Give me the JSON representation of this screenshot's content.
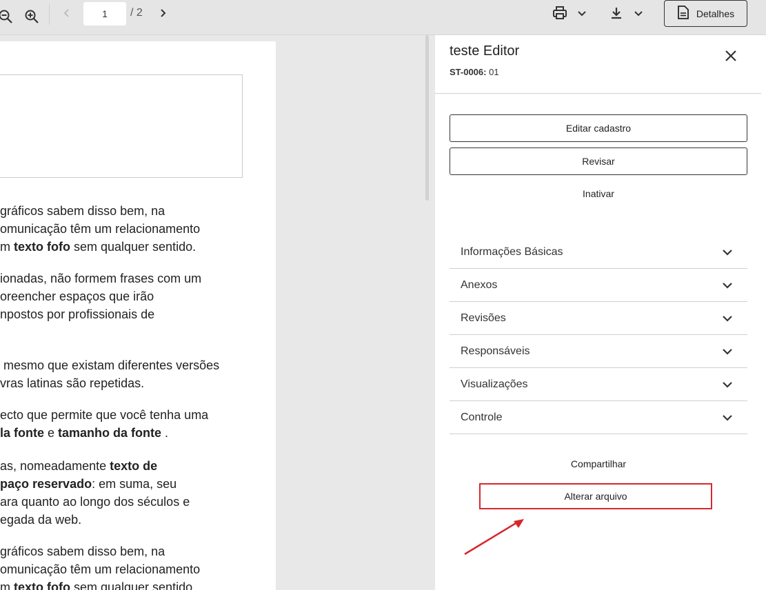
{
  "toolbar": {
    "page_current": "1",
    "page_total": "/ 2",
    "details_label": "Detalhes"
  },
  "document": {
    "lines": [
      {
        "parts": [
          {
            "t": "gráficos sabem disso bem, na"
          }
        ]
      },
      {
        "parts": [
          {
            "t": "omunicação têm um relacionamento"
          }
        ]
      },
      {
        "parts": [
          {
            "t": "m "
          },
          {
            "t": "texto fofo",
            "b": true
          },
          {
            "t": " sem qualquer sentido."
          }
        ]
      },
      {
        "parts": [
          {
            "t": "ionadas, não formem frases com um"
          }
        ]
      },
      {
        "parts": [
          {
            "t": "oreencher espaços que irão"
          }
        ]
      },
      {
        "parts": [
          {
            "t": "npostos por profissionais de"
          }
        ]
      },
      {
        "parts": [
          {
            "t": " mesmo que existam diferentes versões"
          }
        ]
      },
      {
        "parts": [
          {
            "t": "vras latinas são repetidas."
          }
        ]
      },
      {
        "parts": [
          {
            "t": "ecto que permite que você tenha uma"
          }
        ]
      },
      {
        "parts": [
          {
            "t": "la fonte",
            "b": true
          },
          {
            "t": " e "
          },
          {
            "t": "tamanho da fonte",
            "b": true
          },
          {
            "t": " ."
          }
        ]
      },
      {
        "parts": [
          {
            "t": "as, nomeadamente "
          },
          {
            "t": "texto de",
            "b": true
          }
        ]
      },
      {
        "parts": [
          {
            "t": "paço reservado",
            "b": true
          },
          {
            "t": ": em suma, seu"
          }
        ]
      },
      {
        "parts": [
          {
            "t": "ara quanto ao longo dos séculos e"
          }
        ]
      },
      {
        "parts": [
          {
            "t": "egada da web."
          }
        ]
      },
      {
        "parts": [
          {
            "t": "gráficos sabem disso bem, na"
          }
        ]
      },
      {
        "parts": [
          {
            "t": "omunicação têm um relacionamento"
          }
        ]
      },
      {
        "parts": [
          {
            "t": "m "
          },
          {
            "t": "texto fofo",
            "b": true
          },
          {
            "t": " sem qualquer sentido."
          }
        ]
      }
    ]
  },
  "panel": {
    "title": "teste Editor",
    "code_label": "ST-0006:",
    "code_value": " 01",
    "edit_label": "Editar cadastro",
    "review_label": "Revisar",
    "deactivate_label": "Inativar",
    "accordion": [
      {
        "label": "Informações Básicas"
      },
      {
        "label": "Anexos"
      },
      {
        "label": "Revisões"
      },
      {
        "label": "Responsáveis"
      },
      {
        "label": "Visualizações"
      },
      {
        "label": "Controle"
      }
    ],
    "share_label": "Compartilhar",
    "change_file_label": "Alterar arquivo"
  },
  "colors": {
    "highlight": "#d9262b",
    "toolbar_bg": "#e5e5e5"
  }
}
